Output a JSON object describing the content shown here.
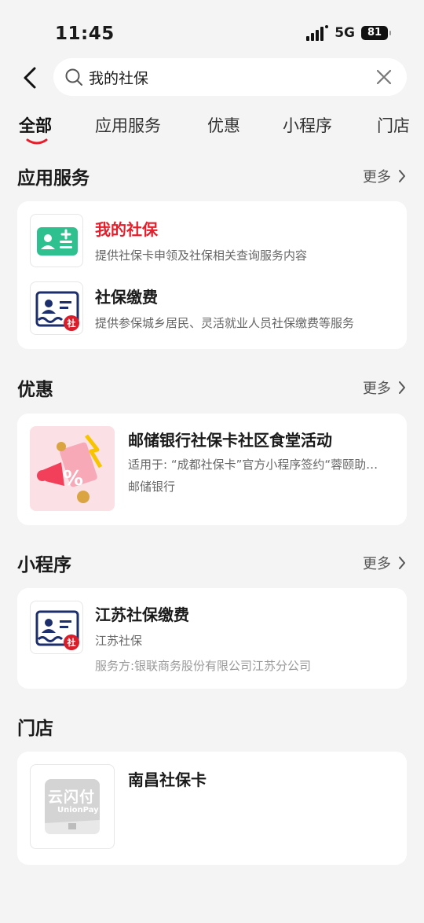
{
  "status": {
    "time": "11:45",
    "network": "5G",
    "battery": "81"
  },
  "search": {
    "query": "我的社保"
  },
  "tabs": [
    {
      "label": "全部",
      "active": true
    },
    {
      "label": "应用服务"
    },
    {
      "label": "优惠"
    },
    {
      "label": "小程序"
    },
    {
      "label": "门店"
    }
  ],
  "sections": {
    "services": {
      "title": "应用服务",
      "more": "更多",
      "items": [
        {
          "title": "我的社保",
          "desc": "提供社保卡申领及社保相关查询服务内容",
          "icon": "id-card-add-icon"
        },
        {
          "title": "社保缴费",
          "desc": "提供参保城乡居民、灵活就业人员社保缴费等服务",
          "icon": "social-security-card-icon",
          "badge": "社"
        }
      ]
    },
    "offers": {
      "title": "优惠",
      "more": "更多",
      "items": [
        {
          "title": "邮储银行社保卡社区食堂活动",
          "desc": "适用于: “成都社保卡”官方小程序签约“蓉颐助…",
          "merchant": "邮储银行",
          "icon": "promo-discount-icon"
        }
      ]
    },
    "miniprograms": {
      "title": "小程序",
      "more": "更多",
      "items": [
        {
          "title": "江苏社保缴费",
          "sub": "江苏社保",
          "provider": "服务方:银联商务股份有限公司江苏分公司",
          "icon": "social-security-card-icon",
          "badge": "社"
        }
      ]
    },
    "stores": {
      "title": "门店",
      "items": [
        {
          "title": "南昌社保卡",
          "logo_text": "云闪付",
          "logo_sub": "UnionPay",
          "icon": "unionpay-logo-icon"
        }
      ]
    }
  },
  "colors": {
    "accent_red": "#e41e2b",
    "green": "#2ec18f",
    "navy": "#1d2e6c"
  }
}
